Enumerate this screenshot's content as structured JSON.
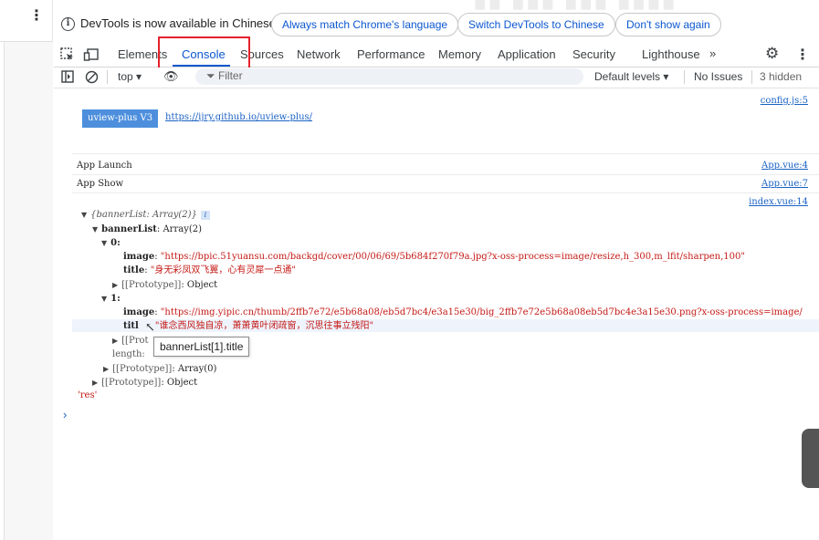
{
  "infobar": {
    "message": "DevTools is now available in Chinese!",
    "btn_match": "Always match Chrome's language",
    "btn_switch": "Switch DevTools to Chinese",
    "btn_dismiss": "Don't show again"
  },
  "tabs": [
    {
      "label": "Elements"
    },
    {
      "label": "Console"
    },
    {
      "label": "Sources"
    },
    {
      "label": "Network"
    },
    {
      "label": "Performance"
    },
    {
      "label": "Memory"
    },
    {
      "label": "Application"
    },
    {
      "label": "Security"
    },
    {
      "label": "Lighthouse"
    }
  ],
  "tabs_more": "»",
  "toolbar": {
    "context": "top ▾",
    "filter_placeholder": "Filter",
    "levels": "Default levels ▾",
    "issues": "No Issues",
    "hidden": "3 hidden"
  },
  "console": {
    "src1": "config.js:5",
    "badge": "uview-plus V3",
    "link": "https://ijry.github.io/uview-plus/",
    "log2": "App Launch",
    "src2": "App.vue:4",
    "log3": "App Show",
    "src3": "App.vue:7",
    "src4": "index.vue:14",
    "obj_summary": "{bannerList: Array(2)}",
    "banner_key": "bannerList",
    "banner_val": "Array(2)",
    "idx0": "0:",
    "image_key": "image",
    "title_key": "title",
    "item0_image": "\"https://bpic.51yuansu.com/backgd/cover/00/06/69/5b684f270f79a.jpg?x-oss-process=image/resize,h_300,m_lfit/sharpen,100\"",
    "item0_title": "\"身无彩凤双飞翼，心有灵犀一点通\"",
    "proto_key": "[[Prototype]]",
    "proto_object": "Object",
    "idx1": "1:",
    "item1_image": "\"https://img.yipic.cn/thumb/2ffb7e72/e5b68a08/eb5d7bc4/e3a15e30/big_2ffb7e72e5b68a08eb5d7bc4e3a15e30.png?x-oss-process=image/",
    "item1_title_key_visible": "titl",
    "item1_title": "\"谁念西风独自凉，萧萧黄叶闭疏窗，沉思往事立残阳\"",
    "proto_partial": "[[Prot",
    "length_key": "length:",
    "proto_array": "Array(0)",
    "res": "'res'",
    "tooltip": "bannerList[1].title",
    "prompt": "›"
  }
}
